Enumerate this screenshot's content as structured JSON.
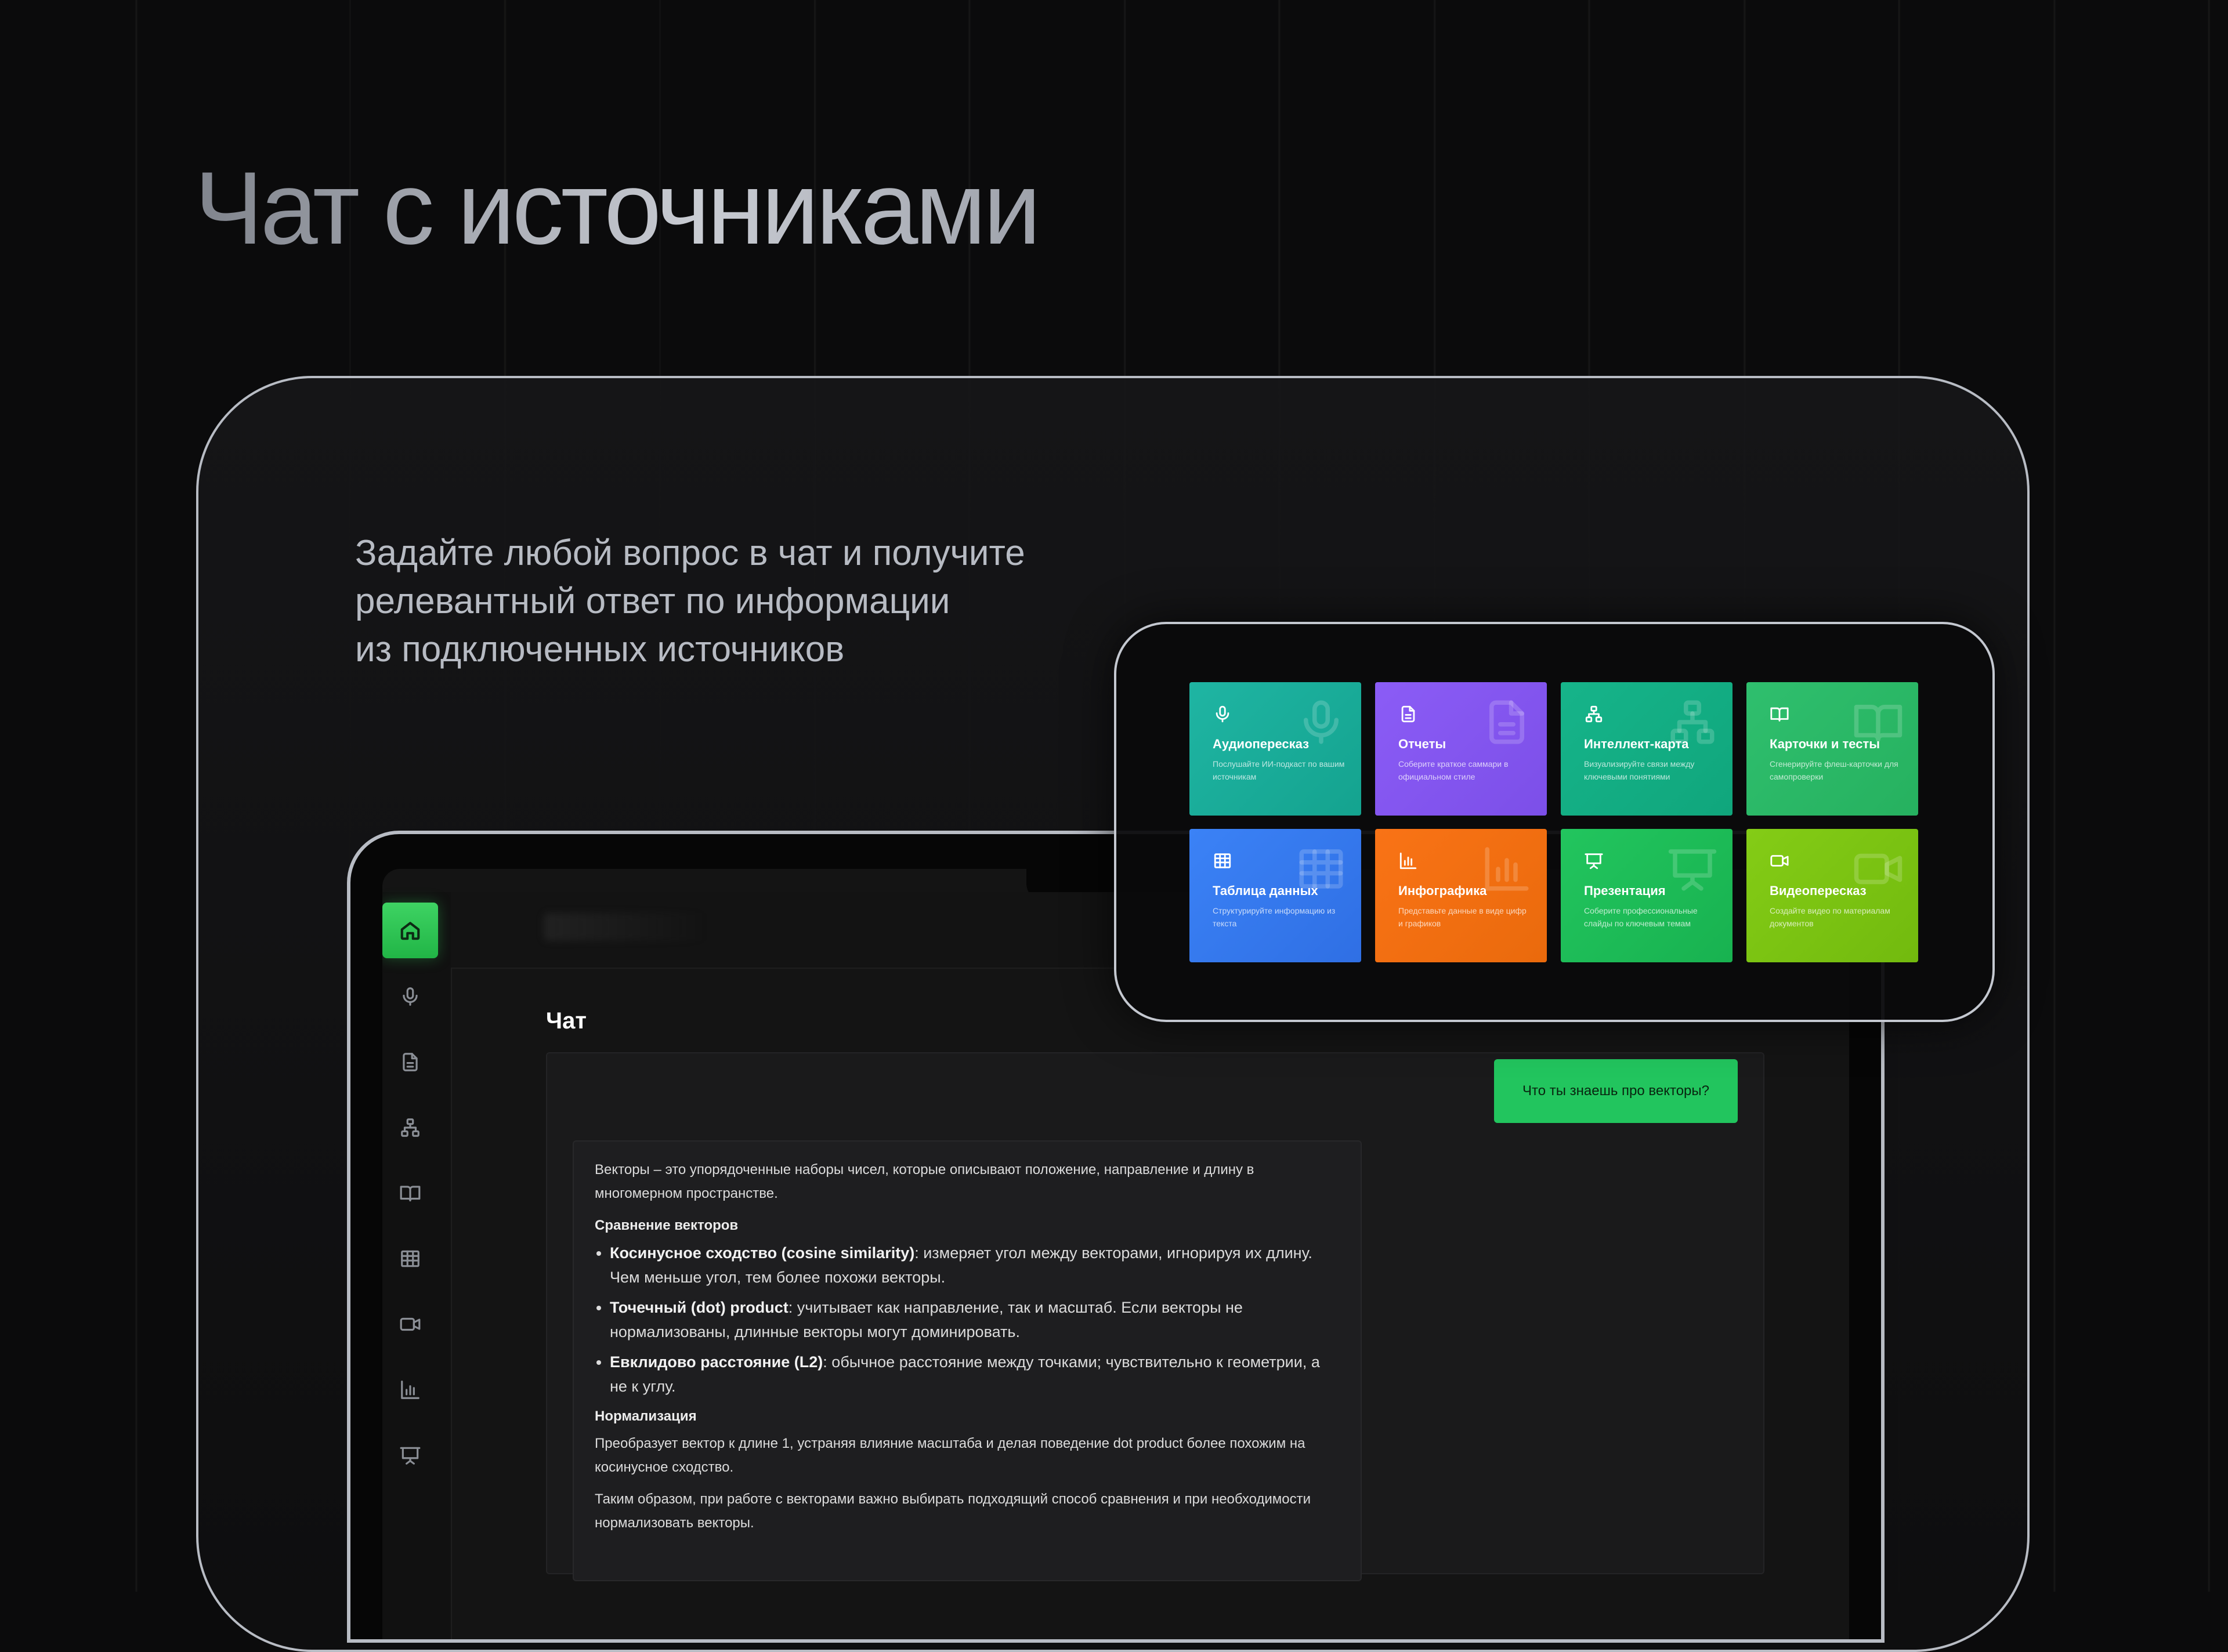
{
  "hero": {
    "title": "Чат с источниками",
    "subtitle_lines": [
      "Задайте любой вопрос в чат и получите",
      "релевантный ответ по информации",
      "из подключенных источников"
    ]
  },
  "sidebar": {
    "items": [
      {
        "icon": "home-icon",
        "active": true
      },
      {
        "icon": "microphone-icon"
      },
      {
        "icon": "document-icon"
      },
      {
        "icon": "mindmap-icon"
      },
      {
        "icon": "book-icon"
      },
      {
        "icon": "table-icon"
      },
      {
        "icon": "video-icon"
      },
      {
        "icon": "bar-chart-icon"
      },
      {
        "icon": "presentation-icon"
      }
    ]
  },
  "chat": {
    "title": "Чат",
    "user_message": "Что ты знаешь про векторы?",
    "answer": {
      "intro": "Векторы – это упорядоченные наборы чисел, которые описывают положение, направление и длину в многомерном пространстве.",
      "section1_title": "Сравнение векторов",
      "bullets": [
        {
          "term": "Косинусное сходство (cosine similarity)",
          "text": ": измеряет угол между векторами, игнорируя их длину. Чем меньше угол, тем более похожи векторы."
        },
        {
          "term": "Точечный (dot) product",
          "text": ": учитывает как направление, так и масштаб. Если векторы не нормализованы, длинные векторы могут доминировать."
        },
        {
          "term": "Евклидово расстояние (L2)",
          "text": ": обычное расстояние между точками; чувствительно к геометрии, а не к углу."
        }
      ],
      "section2_title": "Нормализация",
      "section2_text": "Преобразует вектор к длине 1, устраняя влияние масштаба и делая поведение dot product более похожим на косинусное сходство.",
      "conclusion": "Таким образом, при работе с векторами важно выбирать подходящий способ сравнения и при необходимости нормализовать векторы."
    }
  },
  "features": [
    {
      "title": "Аудиопересказ",
      "desc": "Послушайте ИИ-подкаст по вашим источникам",
      "icon": "microphone-icon",
      "color_from": "#1fb5a3",
      "color_to": "#14a38f"
    },
    {
      "title": "Отчеты",
      "desc": "Соберите краткое саммари в официальном стиле",
      "icon": "document-icon",
      "color_from": "#8b5cf6",
      "color_to": "#7c4fe8"
    },
    {
      "title": "Интеллект-карта",
      "desc": "Визуализируйте связи между ключевыми понятиями",
      "icon": "mindmap-icon",
      "color_from": "#16b48a",
      "color_to": "#10a67c"
    },
    {
      "title": "Карточки и тесты",
      "desc": "Сгенерируйте флеш-карточки для самопроверки",
      "icon": "book-icon",
      "color_from": "#2fbf6e",
      "color_to": "#26b15f"
    },
    {
      "title": "Таблица данных",
      "desc": "Структурируйте информацию из текста",
      "icon": "table-icon",
      "color_from": "#3b82f6",
      "color_to": "#2f6fe4"
    },
    {
      "title": "Инфографика",
      "desc": "Представьте данные в виде цифр и графиков",
      "icon": "bar-chart-icon",
      "color_from": "#f97316",
      "color_to": "#ea6a0c"
    },
    {
      "title": "Презентация",
      "desc": "Соберите профессиональные слайды по ключевым темам",
      "icon": "presentation-icon",
      "color_from": "#22c55e",
      "color_to": "#18b250"
    },
    {
      "title": "Видеопересказ",
      "desc": "Создайте видео по материалам документов",
      "icon": "video-icon",
      "color_from": "#84cc16",
      "color_to": "#72ba0e"
    }
  ]
}
